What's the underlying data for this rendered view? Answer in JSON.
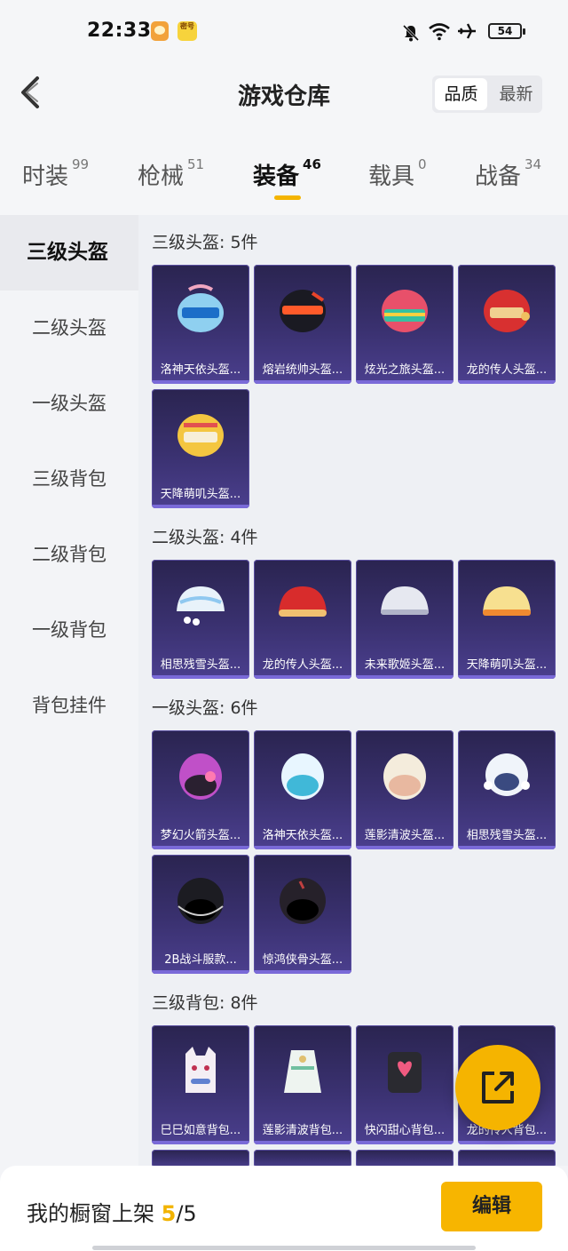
{
  "status_bar": {
    "time": "22:33",
    "battery": "54",
    "app2_label": "密号"
  },
  "header": {
    "title": "游戏仓库",
    "sort_options": [
      "品质",
      "最新"
    ]
  },
  "tabs": [
    {
      "label": "时装",
      "count": "99"
    },
    {
      "label": "枪械",
      "count": "51"
    },
    {
      "label": "装备",
      "count": "46"
    },
    {
      "label": "载具",
      "count": "0"
    },
    {
      "label": "战备",
      "count": "34"
    }
  ],
  "sidebar": [
    "三级头盔",
    "二级头盔",
    "一级头盔",
    "三级背包",
    "二级背包",
    "一级背包",
    "背包挂件"
  ],
  "sections": [
    {
      "title": "三级头盔: 5件",
      "items": [
        "洛神天依头盔...",
        "熔岩统帅头盔...",
        "炫光之旅头盔...",
        "龙的传人头盔...",
        "天降萌叽头盔..."
      ]
    },
    {
      "title": "二级头盔: 4件",
      "items": [
        "相思残雪头盔...",
        "龙的传人头盔...",
        "未来歌姬头盔...",
        "天降萌叽头盔..."
      ]
    },
    {
      "title": "一级头盔: 6件",
      "items": [
        "梦幻火箭头盔...",
        "洛神天依头盔...",
        "莲影清波头盔...",
        "相思残雪头盔...",
        "2B战斗服款...",
        "惊鸿侠骨头盔..."
      ]
    },
    {
      "title": "三级背包: 8件",
      "items": [
        "巳巳如意背包...",
        "莲影清波背包...",
        "快闪甜心背包...",
        "龙的传人背包..."
      ]
    }
  ],
  "bottom": {
    "label": "我的橱窗上架",
    "count_current": "5",
    "count_total": "/5",
    "edit_label": "编辑"
  },
  "colors": {
    "accent": "#f5b400",
    "card_bg": "#2f2960"
  }
}
